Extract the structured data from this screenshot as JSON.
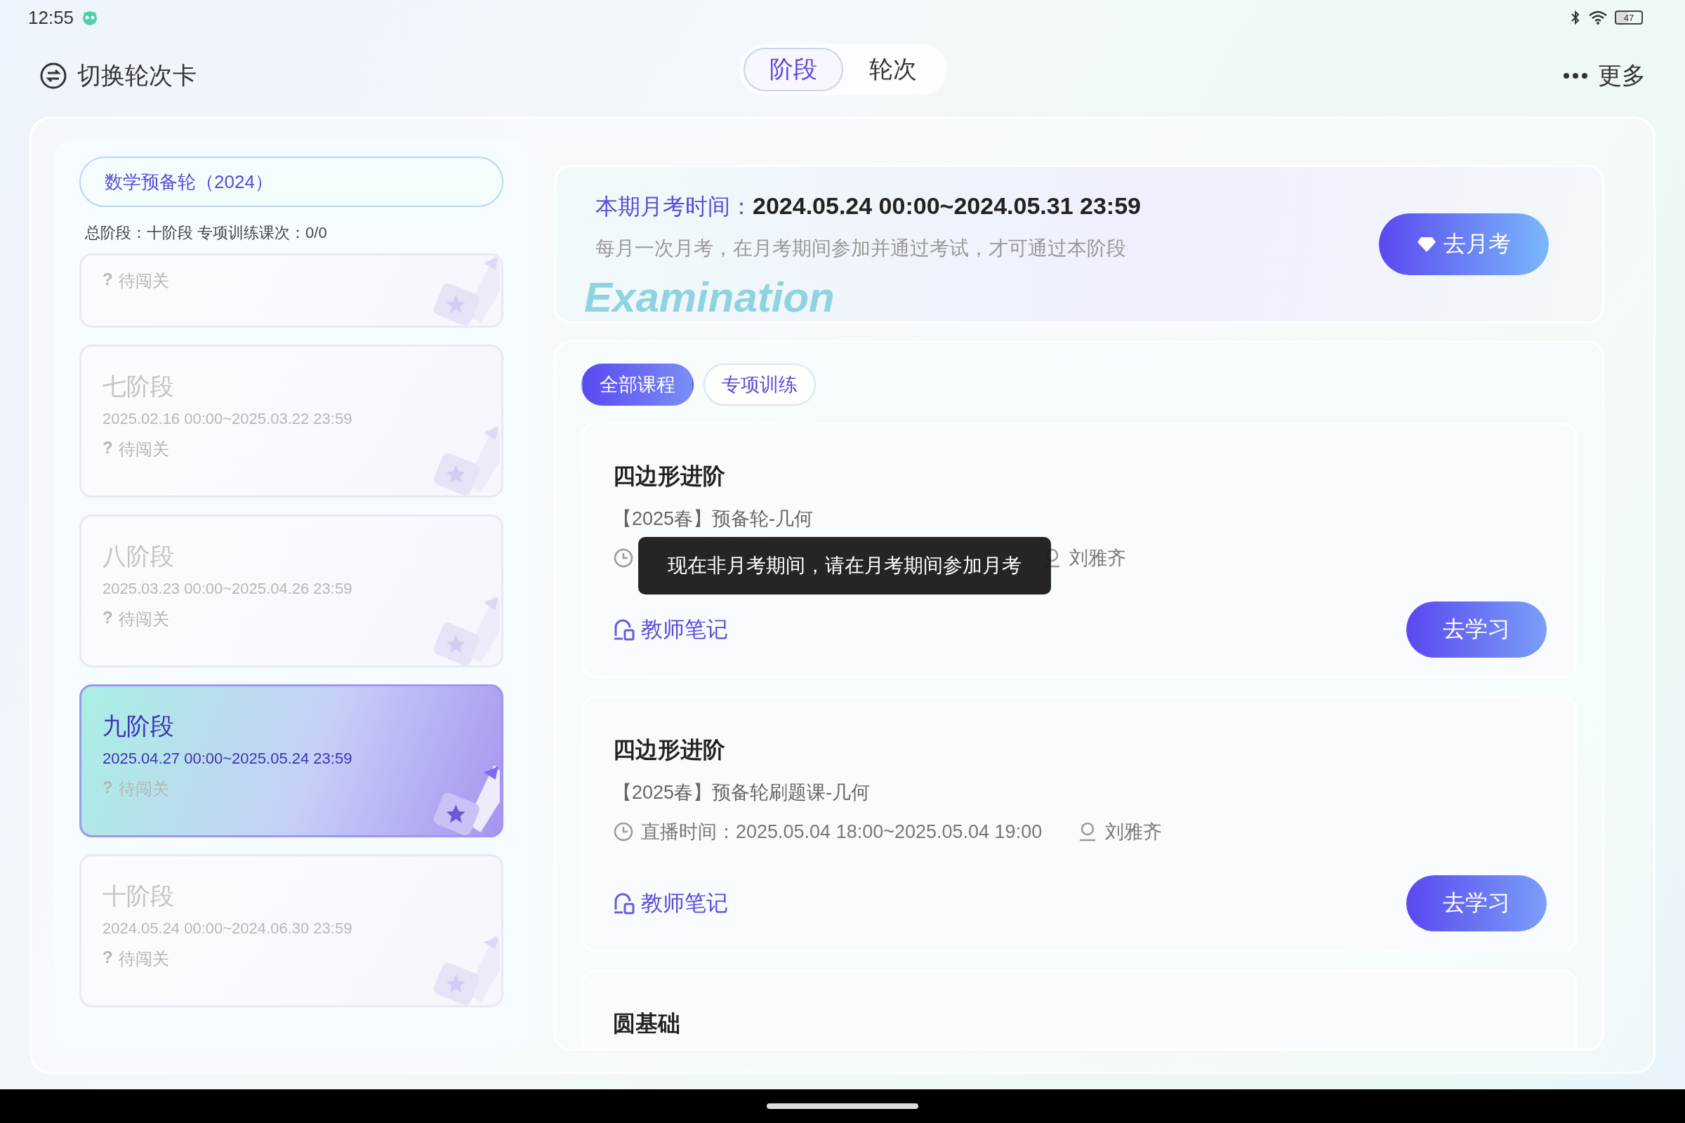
{
  "status_bar": {
    "time": "12:55",
    "battery": "47"
  },
  "header": {
    "switch_label": "切换轮次卡",
    "segments": [
      {
        "label": "阶段",
        "selected": true
      },
      {
        "label": "轮次",
        "selected": false
      }
    ],
    "more_label": "更多"
  },
  "round": {
    "title": "数学预备轮（2024）",
    "summary": "总阶段：十阶段 专项训练课次：0/0"
  },
  "stages": [
    {
      "status_mark": "?",
      "status": "待闯关",
      "selected": false
    },
    {
      "name": "七阶段",
      "dates": "2025.02.16 00:00~2025.03.22 23:59",
      "status_mark": "?",
      "status": "待闯关",
      "selected": false
    },
    {
      "name": "八阶段",
      "dates": "2025.03.23 00:00~2025.04.26 23:59",
      "status_mark": "?",
      "status": "待闯关",
      "selected": false
    },
    {
      "name": "九阶段",
      "dates": "2025.04.27 00:00~2025.05.24 23:59",
      "status_mark": "?",
      "status": "待闯关",
      "selected": true
    },
    {
      "name": "十阶段",
      "dates": "2024.05.24 00:00~2024.06.30 23:59",
      "status_mark": "?",
      "status": "待闯关",
      "selected": false
    }
  ],
  "exam": {
    "label": "本期月考时间：",
    "time": "2024.05.24 00:00~2024.05.31 23:59",
    "note": "每月一次月考，在月考期间参加并通过考试，才可通过本阶段",
    "watermark": "Examination",
    "button": "去月考"
  },
  "course_tabs": [
    {
      "label": "全部课程",
      "selected": true
    },
    {
      "label": "专项训练",
      "selected": false
    }
  ],
  "courses": [
    {
      "title": "四边形进阶",
      "subtitle": "【2025春】预备轮-几何",
      "teacher": "刘雅齐",
      "notes": "教师笔记",
      "button": "去学习"
    },
    {
      "title": "四边形进阶",
      "subtitle": "【2025春】预备轮刷题课-几何",
      "time": "直播时间：2025.05.04 18:00~2025.05.04 19:00",
      "teacher": "刘雅齐",
      "notes": "教师笔记",
      "button": "去学习"
    },
    {
      "title": "圆基础"
    }
  ],
  "toast": "现在非月考期间，请在月考期间参加月考"
}
